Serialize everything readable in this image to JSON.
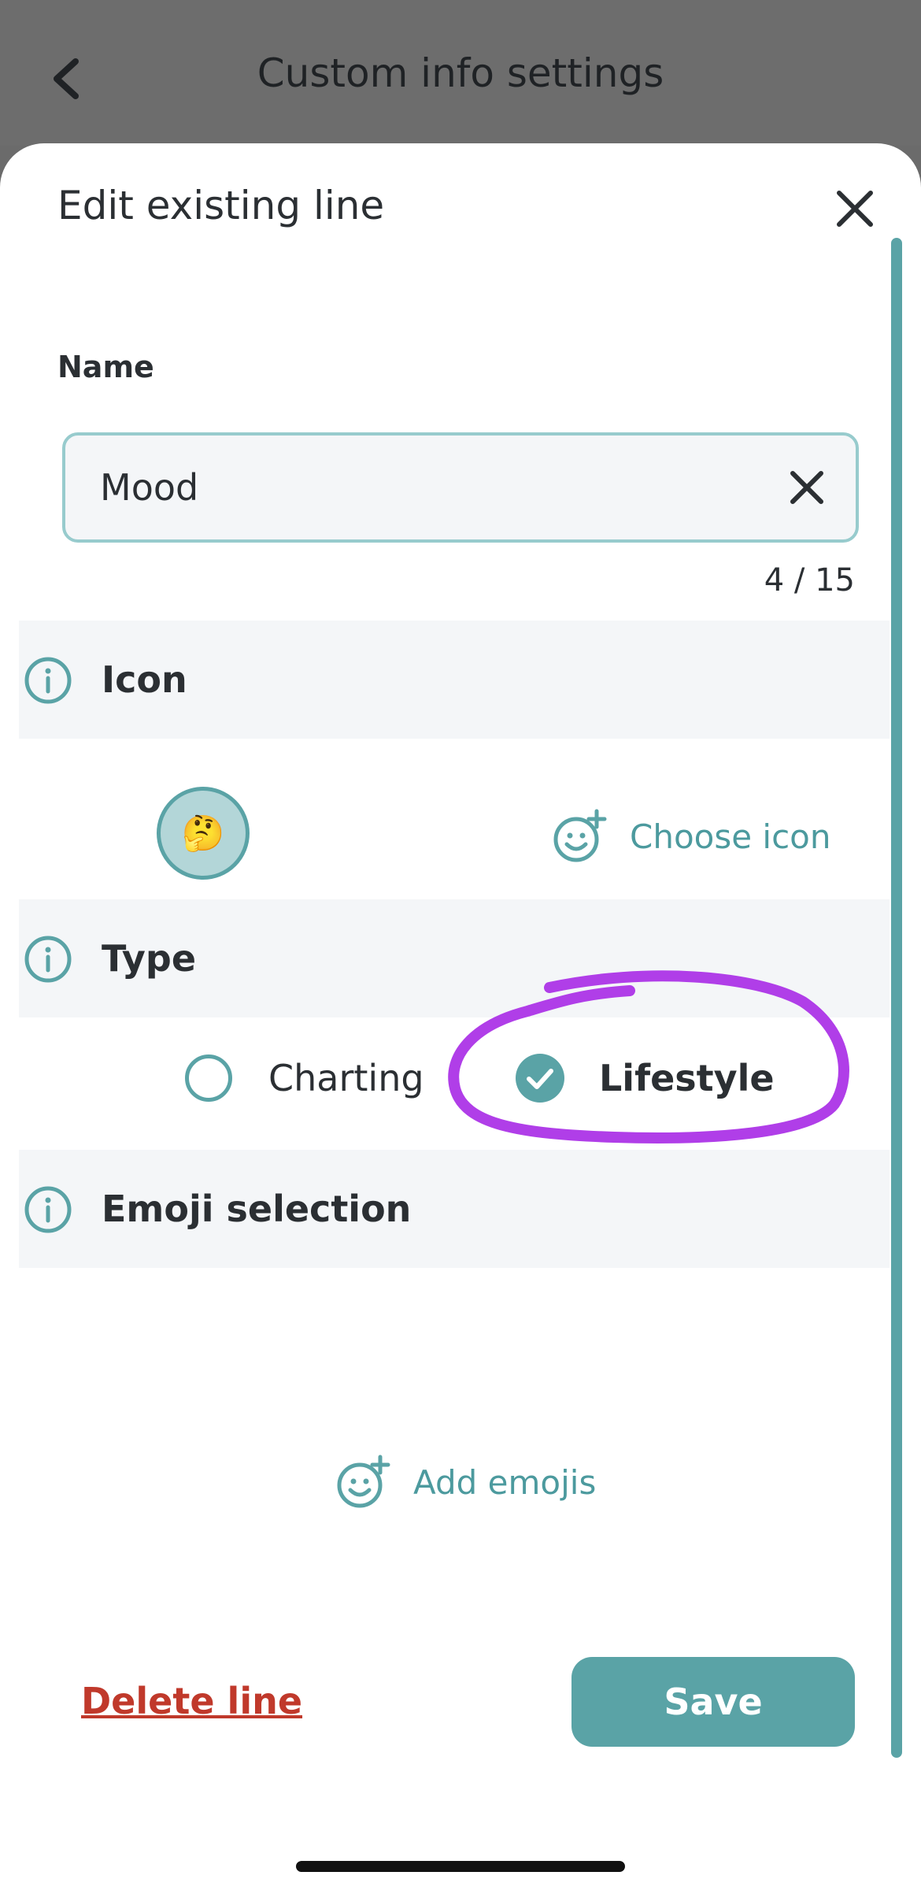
{
  "header": {
    "title": "Custom info settings"
  },
  "modal": {
    "title": "Edit existing line",
    "name_label": "Name",
    "name_value": "Mood",
    "char_counter": "4 / 15",
    "icon_section_label": "Icon",
    "selected_icon": "🤔",
    "choose_icon_label": "Choose icon",
    "type_section_label": "Type",
    "type_options": [
      {
        "label": "Charting",
        "selected": false
      },
      {
        "label": "Lifestyle",
        "selected": true
      }
    ],
    "emoji_section_label": "Emoji selection",
    "add_emojis_label": "Add emojis",
    "delete_label": "Delete line",
    "save_label": "Save"
  },
  "colors": {
    "accent": "#5aa3a6",
    "delete": "#c0392b",
    "highlight_annotation": "#b03ee8"
  },
  "icons": [
    "chevron-left-icon",
    "close-icon",
    "clear-icon",
    "info-icon",
    "add-emoji-icon",
    "check-icon"
  ]
}
